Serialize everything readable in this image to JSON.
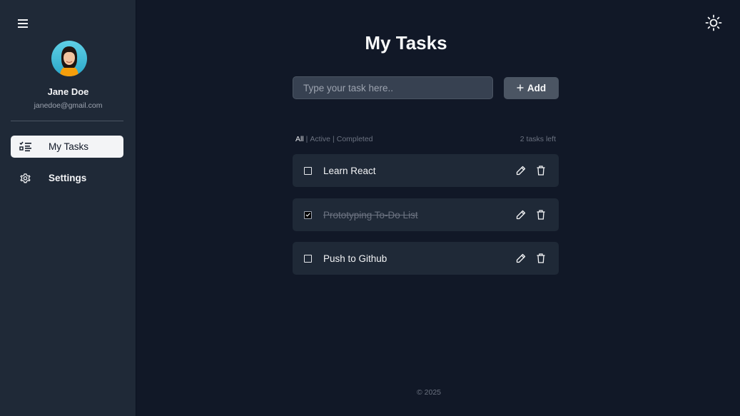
{
  "sidebar": {
    "menu_icon": "hamburger-icon",
    "user": {
      "name": "Jane Doe",
      "email": "janedoe@gmail.com"
    },
    "nav": [
      {
        "label": "My Tasks",
        "icon": "task-list-icon",
        "active": true
      },
      {
        "label": "Settings",
        "icon": "gear-icon",
        "active": false
      }
    ]
  },
  "header": {
    "theme_toggle_icon": "sun-icon"
  },
  "main": {
    "title": "My Tasks",
    "input_placeholder": "Type your task here..",
    "add_label": "Add",
    "filters": [
      "All",
      "Active",
      "Completed"
    ],
    "active_filter": "All",
    "separator": "|",
    "tasks_left": "2 tasks left",
    "tasks": [
      {
        "text": "Learn React",
        "completed": false
      },
      {
        "text": "Prototyping To-Do List",
        "completed": true
      },
      {
        "text": "Push to Github",
        "completed": false
      }
    ]
  },
  "footer": {
    "copyright": "© 2025"
  },
  "colors": {
    "background": "#111827",
    "sidebar": "#1f2937",
    "card": "#1f2937",
    "button": "#4b5563",
    "active_nav": "#f3f4f6"
  }
}
